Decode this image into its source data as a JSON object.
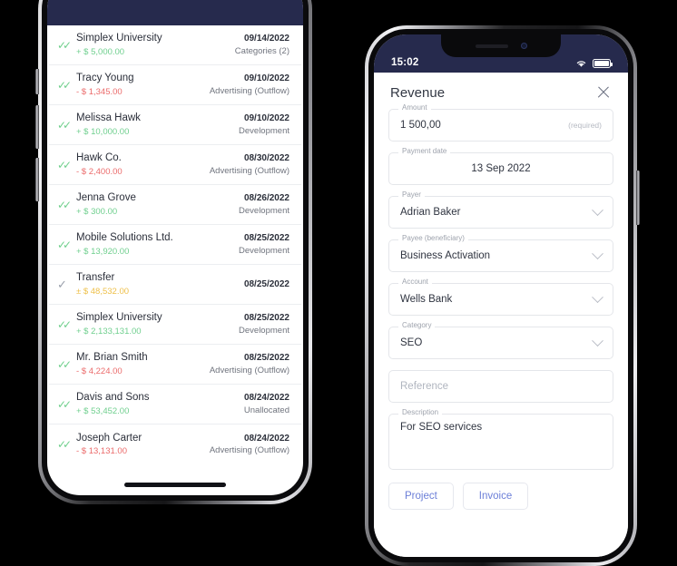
{
  "left_phone": {
    "transactions": [
      {
        "name": "Simplex University",
        "amount": "+ $ 5,000.00",
        "sign": "pos",
        "date": "09/14/2022",
        "category": "Categories (2)",
        "check": "double"
      },
      {
        "name": "Tracy Young",
        "amount": "- $ 1,345.00",
        "sign": "neg",
        "date": "09/10/2022",
        "category": "Advertising (Outflow)",
        "check": "double"
      },
      {
        "name": "Melissa Hawk",
        "amount": "+ $ 10,000.00",
        "sign": "pos",
        "date": "09/10/2022",
        "category": "Development",
        "check": "double"
      },
      {
        "name": "Hawk Co.",
        "amount": "- $ 2,400.00",
        "sign": "neg",
        "date": "08/30/2022",
        "category": "Advertising (Outflow)",
        "check": "double"
      },
      {
        "name": "Jenna Grove",
        "amount": "+ $ 300.00",
        "sign": "pos",
        "date": "08/26/2022",
        "category": "Development",
        "check": "double"
      },
      {
        "name": "Mobile Solutions Ltd.",
        "amount": "+ $ 13,920.00",
        "sign": "pos",
        "date": "08/25/2022",
        "category": "Development",
        "check": "double"
      },
      {
        "name": "Transfer",
        "amount": "± $ 48,532.00",
        "sign": "neu",
        "date": "08/25/2022",
        "category": "",
        "check": "single"
      },
      {
        "name": "Simplex University",
        "amount": "+ $ 2,133,131.00",
        "sign": "pos",
        "date": "08/25/2022",
        "category": "Development",
        "check": "double"
      },
      {
        "name": "Mr. Brian Smith",
        "amount": "- $ 4,224.00",
        "sign": "neg",
        "date": "08/25/2022",
        "category": "Advertising (Outflow)",
        "check": "double"
      },
      {
        "name": "Davis and Sons",
        "amount": "+ $ 53,452.00",
        "sign": "pos",
        "date": "08/24/2022",
        "category": "Unallocated",
        "check": "double"
      },
      {
        "name": "Joseph Carter",
        "amount": "- $ 13,131.00",
        "sign": "neg",
        "date": "08/24/2022",
        "category": "Advertising (Outflow)",
        "check": "double"
      }
    ]
  },
  "right_phone": {
    "status": {
      "time": "15:02",
      "wifi_icon": "wifi-icon",
      "battery_icon": "battery-full-icon"
    },
    "form": {
      "title": "Revenue",
      "close_icon": "close-icon",
      "fields": [
        {
          "label": "Amount",
          "value": "1 500,00",
          "hint": "(required)",
          "type": "text"
        },
        {
          "label": "Payment date",
          "value": "13 Sep 2022",
          "type": "date"
        },
        {
          "label": "Payer",
          "value": "Adrian Baker",
          "type": "select"
        },
        {
          "label": "Payee (beneficiary)",
          "value": "Business Activation",
          "type": "select"
        },
        {
          "label": "Account",
          "value": "Wells Bank",
          "type": "select"
        },
        {
          "label": "Category",
          "value": "SEO",
          "type": "select"
        },
        {
          "label": "",
          "value": "",
          "placeholder": "Reference",
          "type": "text"
        },
        {
          "label": "Description",
          "value": "For SEO services",
          "type": "textarea"
        }
      ],
      "buttons": [
        {
          "label": "Project"
        },
        {
          "label": "Invoice"
        }
      ]
    }
  },
  "colors": {
    "navy": "#262a4d",
    "positive": "#6fcf8e",
    "negative": "#eb6b6b",
    "neutral": "#eec04a",
    "accent": "#6c7fd8"
  }
}
